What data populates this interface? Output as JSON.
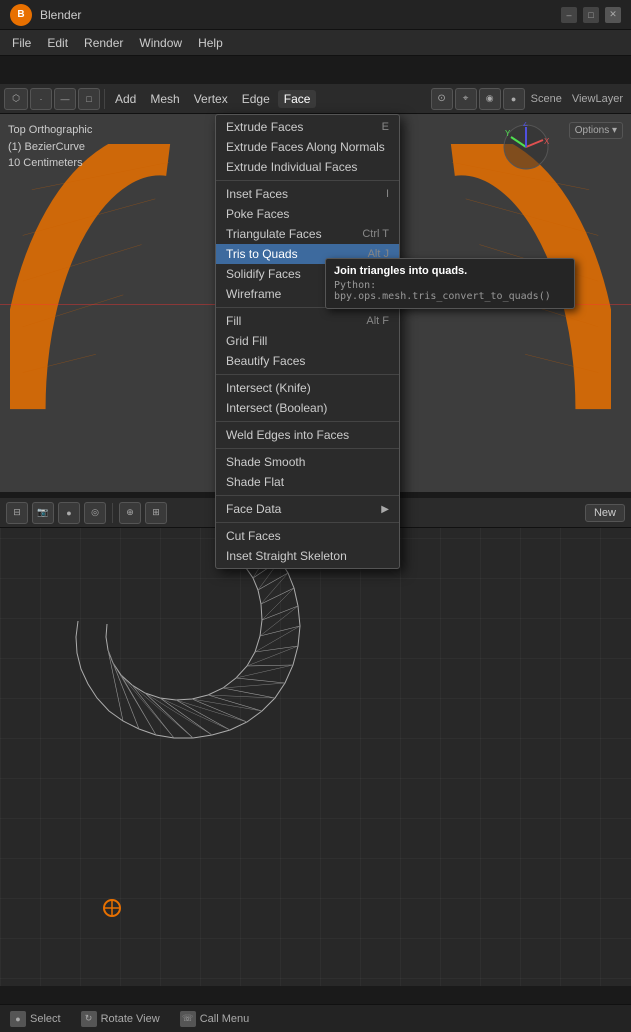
{
  "titlebar": {
    "logo": "B",
    "title": "Blender",
    "controls": [
      "–",
      "□",
      "✕"
    ]
  },
  "menubar": {
    "items": [
      "File",
      "Edit",
      "Render",
      "Window",
      "Help"
    ]
  },
  "header": {
    "left_tabs": [
      "Add",
      "Mesh",
      "Vertex",
      "Edge",
      "Face"
    ],
    "active_context": "Face",
    "view_label": "ViewLayer"
  },
  "viewport_top": {
    "info_line1": "Top Orthographic",
    "info_line2": "(1) BezierCurve",
    "info_line3": "10 Centimeters",
    "axis_x": "X",
    "axis_y": "Y",
    "axis_z": "Z"
  },
  "face_menu": {
    "items": [
      {
        "label": "Extrude Faces",
        "shortcut": "E",
        "has_arrow": false
      },
      {
        "label": "Extrude Faces Along Normals",
        "shortcut": "",
        "has_arrow": false
      },
      {
        "label": "Extrude Individual Faces",
        "shortcut": "",
        "has_arrow": false
      },
      {
        "separator": true
      },
      {
        "label": "Inset Faces",
        "shortcut": "I",
        "has_arrow": false
      },
      {
        "label": "Poke Faces",
        "shortcut": "",
        "has_arrow": false
      },
      {
        "label": "Triangulate Faces",
        "shortcut": "Ctrl T",
        "has_arrow": false
      },
      {
        "label": "Tris to Quads",
        "shortcut": "Alt J",
        "has_arrow": false,
        "highlighted": true
      },
      {
        "label": "Solidify Faces",
        "shortcut": "",
        "has_arrow": false
      },
      {
        "label": "Wireframe",
        "shortcut": "",
        "has_arrow": false
      },
      {
        "separator": true
      },
      {
        "label": "Fill",
        "shortcut": "Alt F",
        "has_arrow": false
      },
      {
        "label": "Grid Fill",
        "shortcut": "",
        "has_arrow": false
      },
      {
        "label": "Beautify Faces",
        "shortcut": "",
        "has_arrow": false
      },
      {
        "separator": true
      },
      {
        "label": "Intersect (Knife)",
        "shortcut": "",
        "has_arrow": false
      },
      {
        "label": "Intersect (Boolean)",
        "shortcut": "",
        "has_arrow": false
      },
      {
        "separator": true
      },
      {
        "label": "Weld Edges into Faces",
        "shortcut": "",
        "has_arrow": false
      },
      {
        "separator": true
      },
      {
        "label": "Shade Smooth",
        "shortcut": "",
        "has_arrow": false
      },
      {
        "label": "Shade Flat",
        "shortcut": "",
        "has_arrow": false
      },
      {
        "separator": true
      },
      {
        "label": "Face Data",
        "shortcut": "",
        "has_arrow": true
      },
      {
        "separator": true
      },
      {
        "label": "Cut Faces",
        "shortcut": "",
        "has_arrow": false
      },
      {
        "label": "Inset Straight Skeleton",
        "shortcut": "",
        "has_arrow": false
      }
    ]
  },
  "tooltip": {
    "title": "Join triangles into quads.",
    "code": "Python: bpy.ops.mesh.tris_convert_to_quads()"
  },
  "bottom_toolbar": {
    "new_label": "New"
  },
  "statusbar": {
    "items": [
      {
        "icon": "●",
        "label": "Select"
      },
      {
        "icon": "↻",
        "label": "Rotate View"
      },
      {
        "icon": "☏",
        "label": "Call Menu"
      }
    ]
  }
}
